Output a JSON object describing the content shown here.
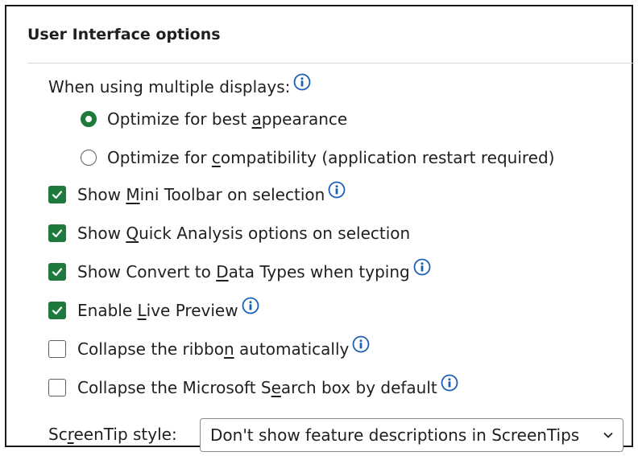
{
  "section": {
    "title": "User Interface options"
  },
  "multi_display": {
    "label": "When using multiple displays:",
    "options": [
      {
        "pre": "Optimize for best ",
        "u": "a",
        "post": "ppearance",
        "selected": true
      },
      {
        "pre": "Optimize for ",
        "u": "c",
        "post": "ompatibility (application restart required)",
        "selected": false
      }
    ]
  },
  "checkboxes": [
    {
      "pre": "Show ",
      "u": "M",
      "post": "ini Toolbar on selection",
      "checked": true,
      "info": true
    },
    {
      "pre": "Show ",
      "u": "Q",
      "post": "uick Analysis options on selection",
      "checked": true,
      "info": false
    },
    {
      "pre": "Show Convert to ",
      "u": "D",
      "post": "ata Types when typing",
      "checked": true,
      "info": true
    },
    {
      "pre": "Enable ",
      "u": "L",
      "post": "ive Preview",
      "checked": true,
      "info": true
    },
    {
      "pre": "Collapse the ribbo",
      "u": "n",
      "post": " automatically",
      "checked": false,
      "info": true
    },
    {
      "pre": "Collapse the Microsoft S",
      "u": "e",
      "post": "arch box by default",
      "checked": false,
      "info": true
    }
  ],
  "screentip": {
    "label_pre": "Sc",
    "label_u": "r",
    "label_post": "eenTip style:",
    "selected_value": "Don't show feature descriptions in ScreenTips"
  },
  "colors": {
    "accent": "#1e7a3c",
    "info": "#1a5fb4"
  },
  "icons": {
    "info": "info-icon",
    "check": "checkmark-icon",
    "dropdown": "chevron-down-icon"
  }
}
